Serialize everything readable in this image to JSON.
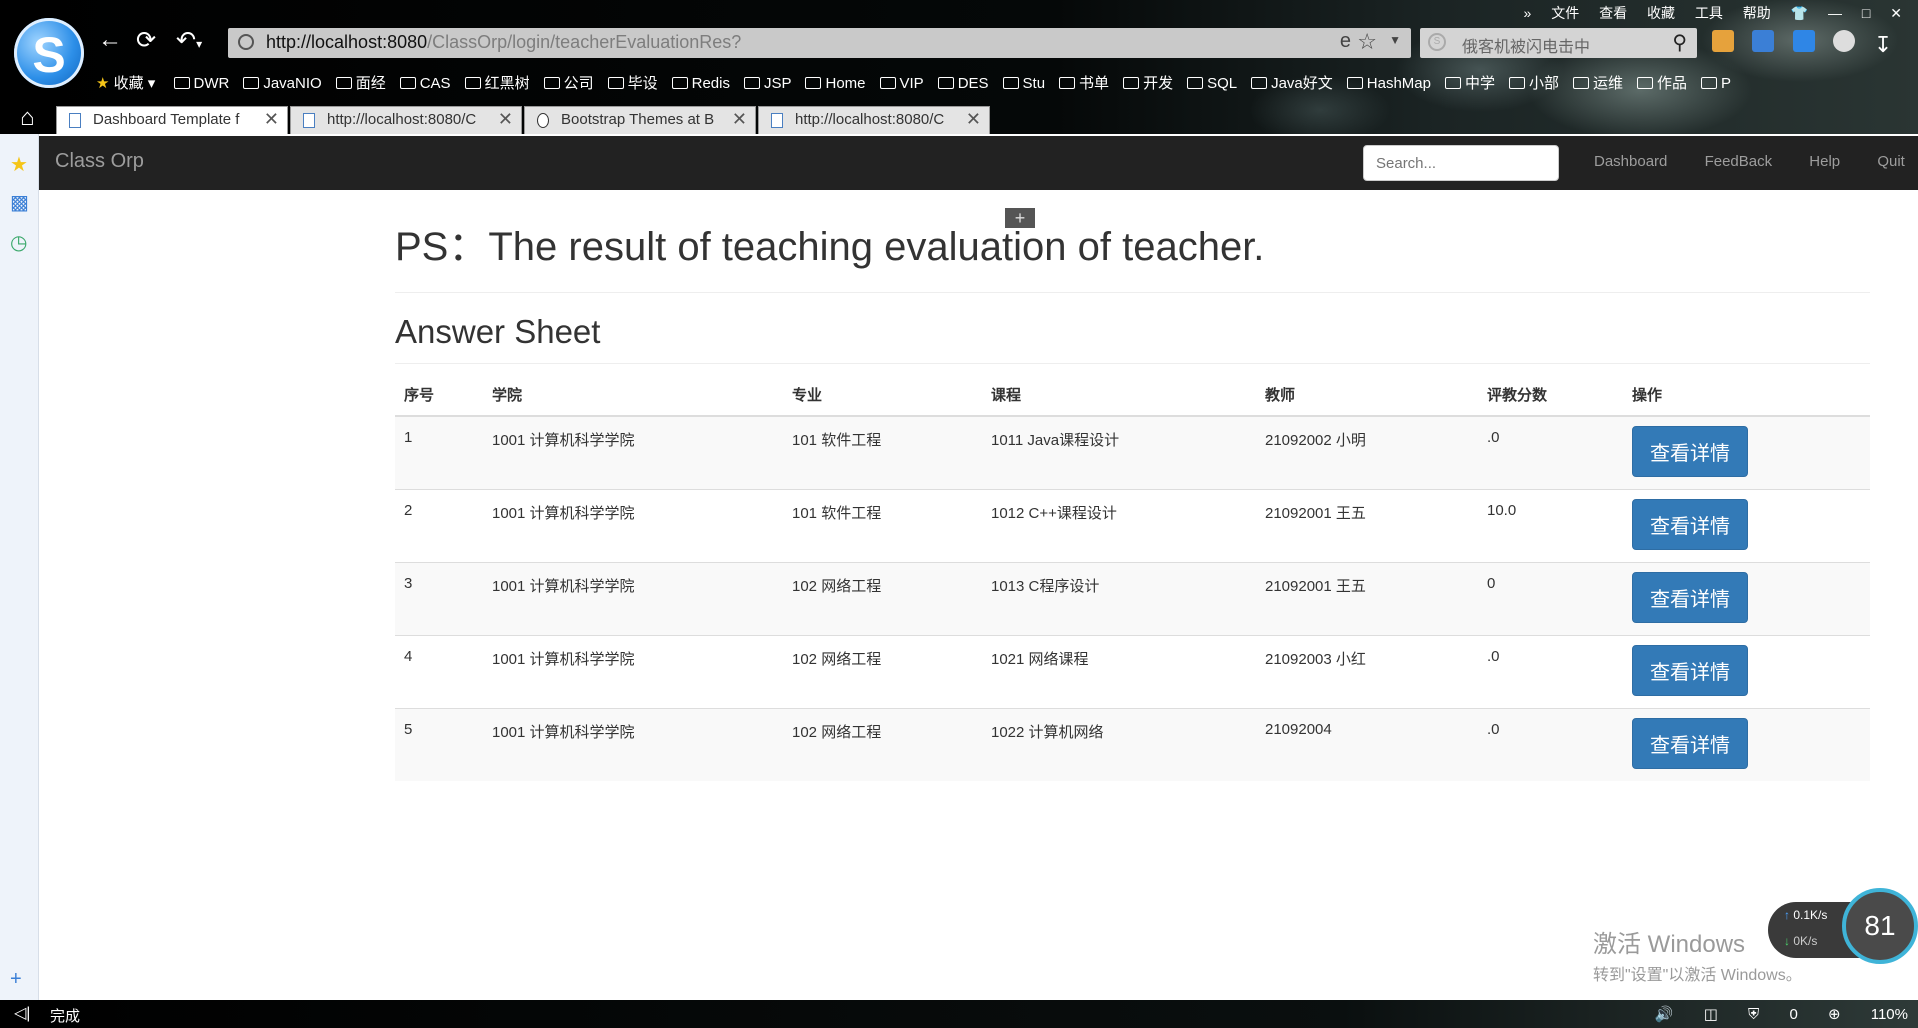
{
  "browser": {
    "url_host": "http://localhost:8080",
    "url_path": "/ClassOrp/login/teacherEvaluationRes?",
    "search_placeholder": "俄客机被闪电击中",
    "menu": [
      "文件",
      "查看",
      "收藏",
      "工具",
      "帮助"
    ],
    "bookmarks_fav": "收藏",
    "bookmarks": [
      "DWR",
      "JavaNIO",
      "面经",
      "CAS",
      "红黑树",
      "公司",
      "毕设",
      "Redis",
      "JSP",
      "Home",
      "VIP",
      "DES",
      "Stu",
      "书单",
      "开发",
      "SQL",
      "Java好文",
      "HashMap",
      "中学",
      "小部",
      "运维",
      "作品",
      "P"
    ],
    "tabs": [
      {
        "label": "Dashboard Template f"
      },
      {
        "label": "http://localhost:8080/C"
      },
      {
        "label": "Bootstrap Themes at B"
      },
      {
        "label": "http://localhost:8080/C"
      }
    ],
    "status": "完成",
    "status_right": [
      "0",
      "110%"
    ]
  },
  "nav": {
    "brand": "Class Orp",
    "search_placeholder": "Search...",
    "links": [
      "Dashboard",
      "FeedBack",
      "Help",
      "Quit"
    ]
  },
  "page": {
    "title": "PS：The result of teaching evaluation of teacher.",
    "section": "Answer Sheet"
  },
  "table": {
    "headers": [
      "序号",
      "学院",
      "专业",
      "课程",
      "教师",
      "评教分数",
      "操作"
    ],
    "action_label": "查看详情",
    "rows": [
      [
        "1",
        "1001 计算机科学学院",
        "101 软件工程",
        "1011 Java课程设计",
        "21092002 小明",
        ".0"
      ],
      [
        "2",
        "1001 计算机科学学院",
        "101 软件工程",
        "1012 C++课程设计",
        "21092001 王五",
        "10.0"
      ],
      [
        "3",
        "1001 计算机科学学院",
        "102 网络工程",
        "1013 C程序设计",
        "21092001 王五",
        "0"
      ],
      [
        "4",
        "1001 计算机科学学院",
        "102 网络工程",
        "1021 网络课程",
        "21092003 小红",
        ".0"
      ],
      [
        "5",
        "1001 计算机科学学院",
        "102 网络工程",
        "1022 计算机网络",
        "21092004",
        ".0"
      ]
    ]
  },
  "overlay": {
    "watermark_line1": "激活 Windows",
    "watermark_line2": "转到\"设置\"以激活 Windows。",
    "net_up": "0.1K/s",
    "net_down": "0K/s",
    "gauge": "81"
  },
  "colors": {
    "primary": "#337ab7",
    "navbar": "#222222"
  }
}
